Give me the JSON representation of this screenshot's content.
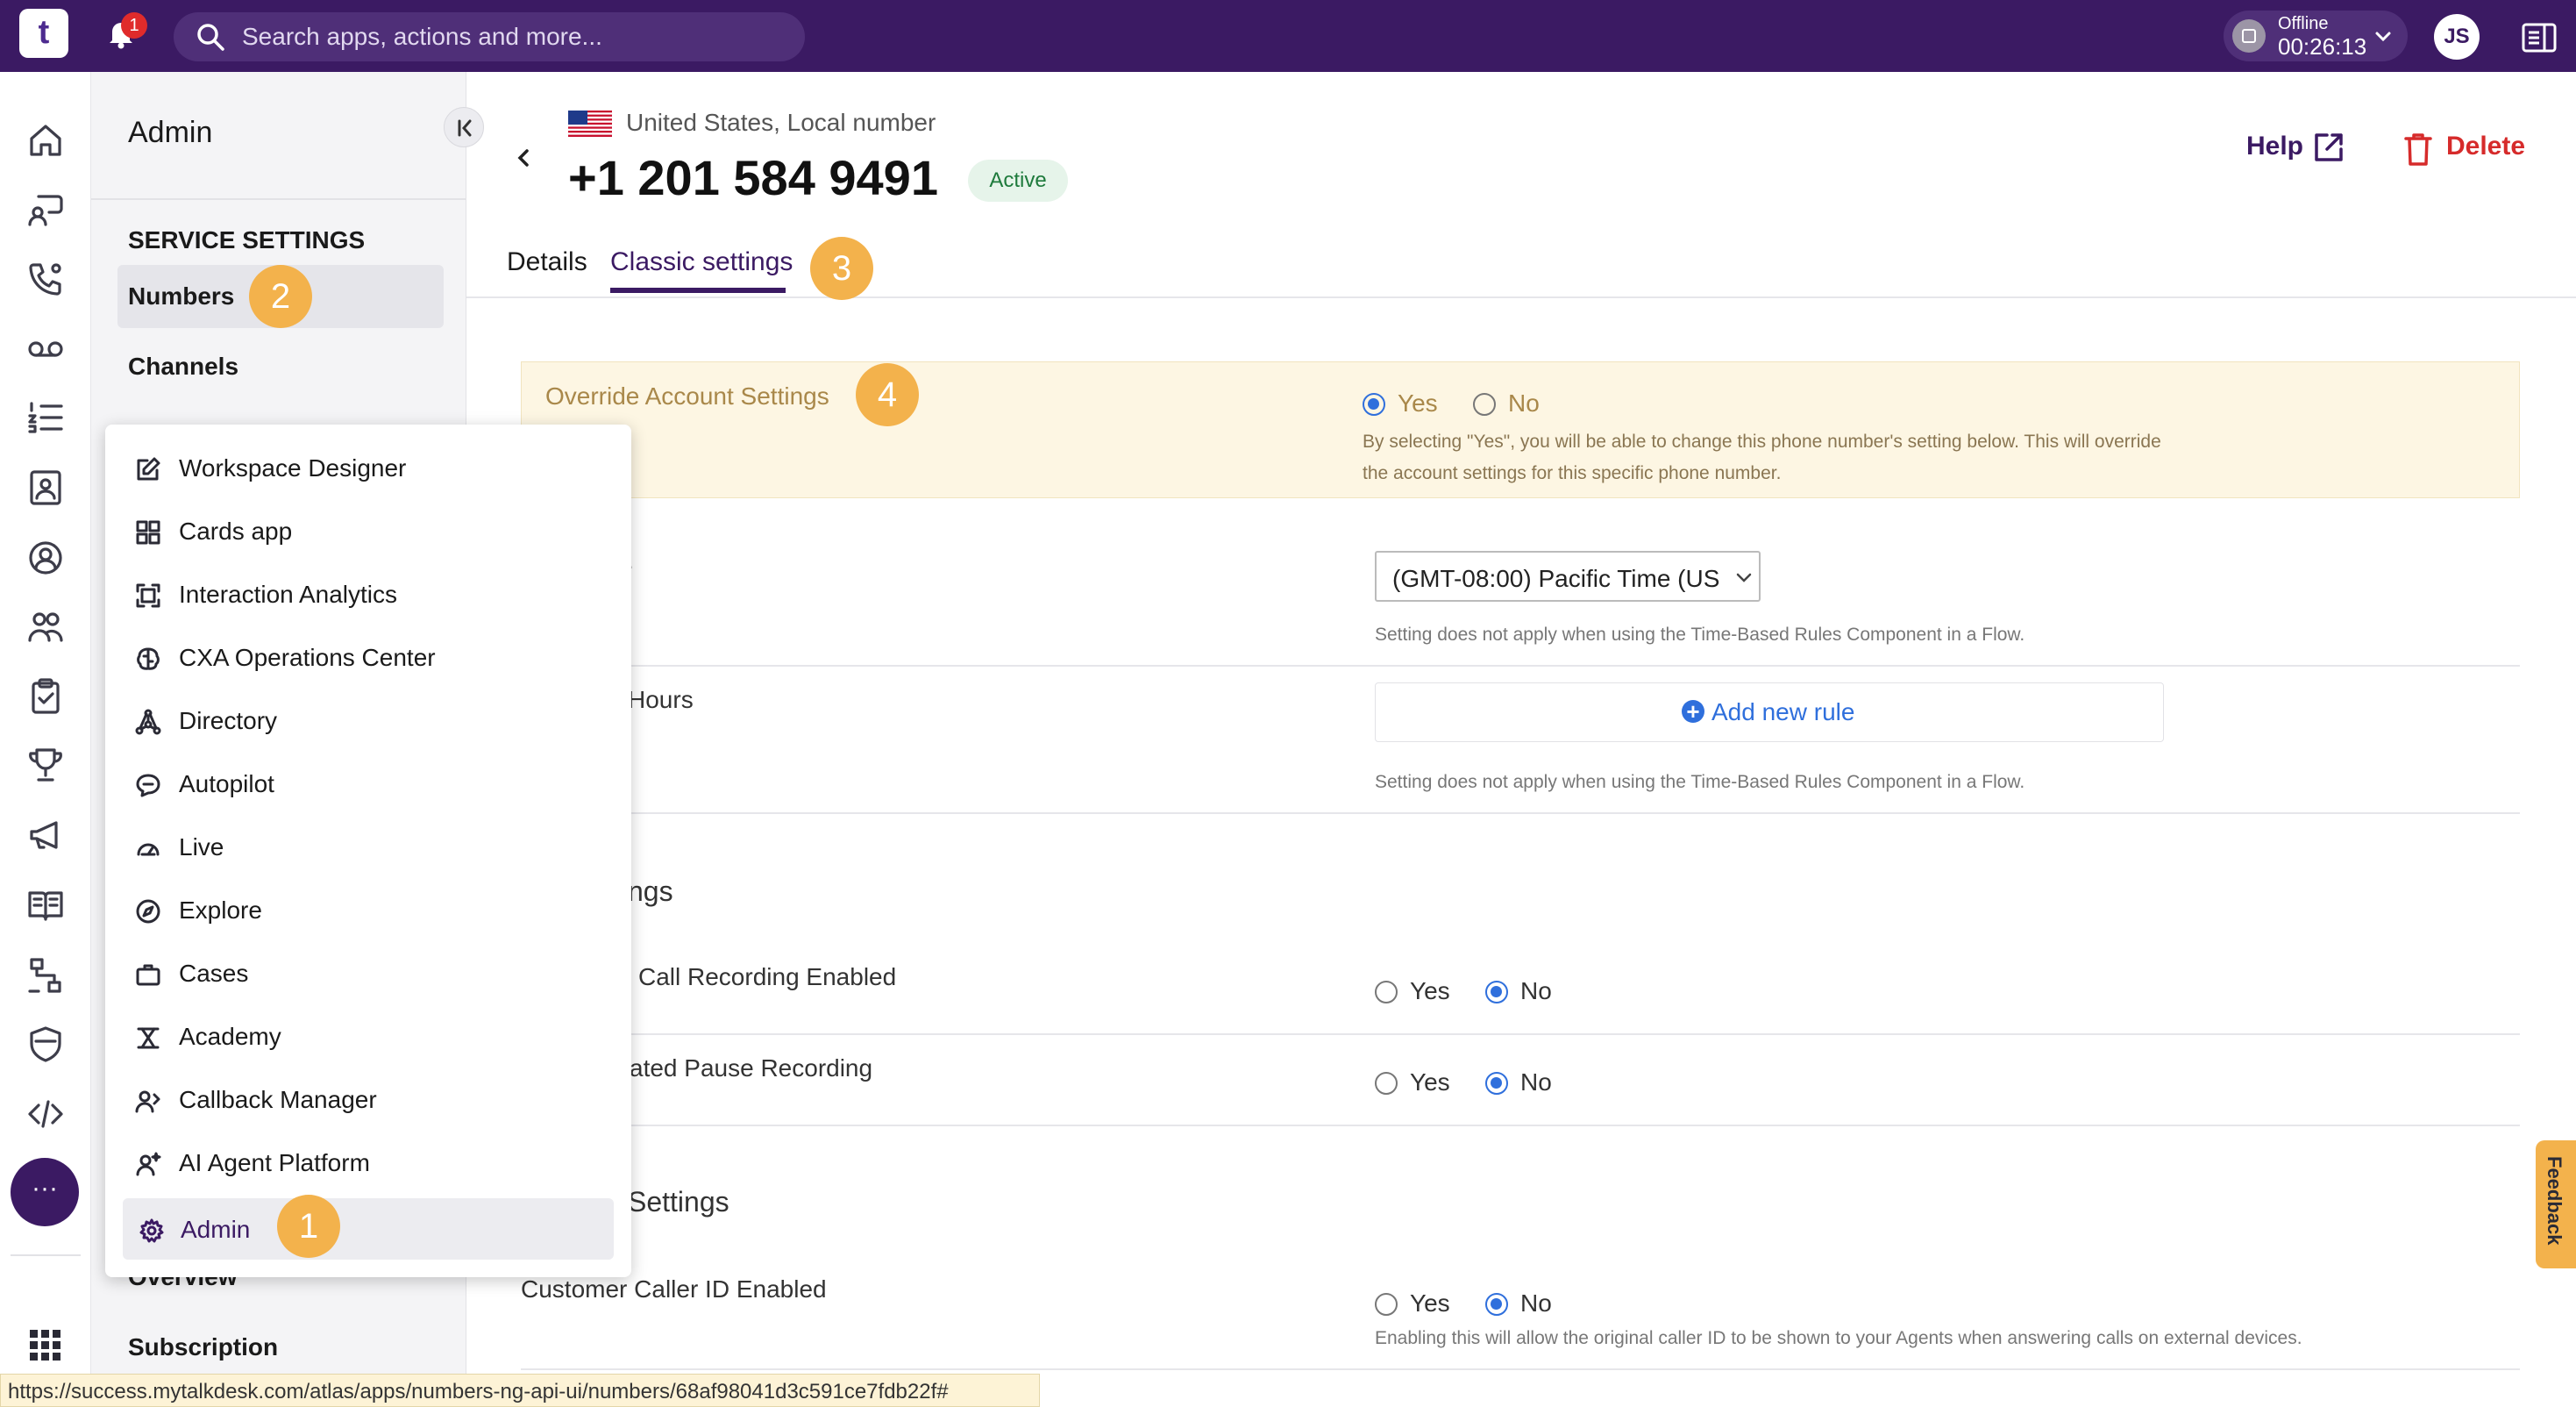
{
  "topbar": {
    "logo_glyph": "t",
    "notification_count": "1",
    "search_placeholder": "Search apps, actions and more...",
    "status_label": "Offline",
    "status_timer": "00:26:13",
    "avatar_initials": "JS"
  },
  "rail": {
    "more_glyph": "···",
    "icons": [
      "home-icon",
      "chat-icon",
      "phone-icon",
      "voicemail-icon",
      "list-icon",
      "contact-card-icon",
      "agent-icon",
      "team-icon",
      "clipboard-icon",
      "trophy-icon",
      "megaphone-icon",
      "book-icon",
      "flow-icon",
      "shield-icon",
      "code-icon"
    ]
  },
  "sidebar": {
    "title": "Admin",
    "section_heading": "SERVICE SETTINGS",
    "items": [
      "Numbers",
      "Channels",
      "Overview",
      "Subscription"
    ]
  },
  "app_menu": {
    "items": [
      {
        "label": "Workspace Designer",
        "icon": "edit-icon"
      },
      {
        "label": "Cards app",
        "icon": "grid-icon"
      },
      {
        "label": "Interaction Analytics",
        "icon": "frame-icon"
      },
      {
        "label": "CXA Operations Center",
        "icon": "brain-icon"
      },
      {
        "label": "Directory",
        "icon": "network-icon"
      },
      {
        "label": "Autopilot",
        "icon": "bubble-icon"
      },
      {
        "label": "Live",
        "icon": "gauge-icon"
      },
      {
        "label": "Explore",
        "icon": "compass-icon"
      },
      {
        "label": "Cases",
        "icon": "briefcase-icon"
      },
      {
        "label": "Academy",
        "icon": "academy-icon"
      },
      {
        "label": "Callback Manager",
        "icon": "callback-icon"
      },
      {
        "label": "AI Agent Platform",
        "icon": "ai-agent-icon"
      },
      {
        "label": "Admin",
        "icon": "gear-icon",
        "selected": true
      }
    ]
  },
  "markers": [
    "1",
    "2",
    "3",
    "4"
  ],
  "number": {
    "country": "United States, Local number",
    "phone": "+1 201 584 9491",
    "status": "Active"
  },
  "actions": {
    "help": "Help",
    "delete": "Delete"
  },
  "tabs": [
    "Details",
    "Classic settings"
  ],
  "override": {
    "label": "Override Account Settings",
    "yes": "Yes",
    "no": "No",
    "selected": "Yes",
    "help": "By selecting \"Yes\", you will be able to change this phone number's setting below. This will override the account settings for this specific phone number."
  },
  "timezone": {
    "label_fragment": "e",
    "value": "(GMT-08:00) Pacific Time (US",
    "help": "Setting does not apply when using the Time-Based Rules Component in a Flow."
  },
  "hours": {
    "label_fragment": "Hours",
    "add_rule": "Add new rule",
    "help": "Setting does not apply when using the Time-Based Rules Component in a Flow."
  },
  "recording_settings": {
    "heading_fragment": "ngs",
    "call_recording_label": "Call Recording Enabled",
    "pause_recording_label": "ated Pause Recording",
    "yes": "Yes",
    "no": "No"
  },
  "caller_settings": {
    "heading_fragment": "Settings",
    "caller_id_label": "Customer Caller ID Enabled",
    "yes": "Yes",
    "no": "No",
    "help": "Enabling this will allow the original caller ID to be shown to your Agents when answering calls on external devices."
  },
  "feedback_label": "Feedback",
  "status_url": "https://success.mytalkdesk.com/atlas/apps/numbers-ng-api-ui/numbers/68af98041d3c591ce7fdb22f#",
  "colors": {
    "topbar": "#3b1a63",
    "accent": "#3b1a63",
    "radio": "#2f6fdc",
    "marker": "#f3b24c",
    "delete": "#d62b2b",
    "active_badge": "#1e7a3c"
  }
}
